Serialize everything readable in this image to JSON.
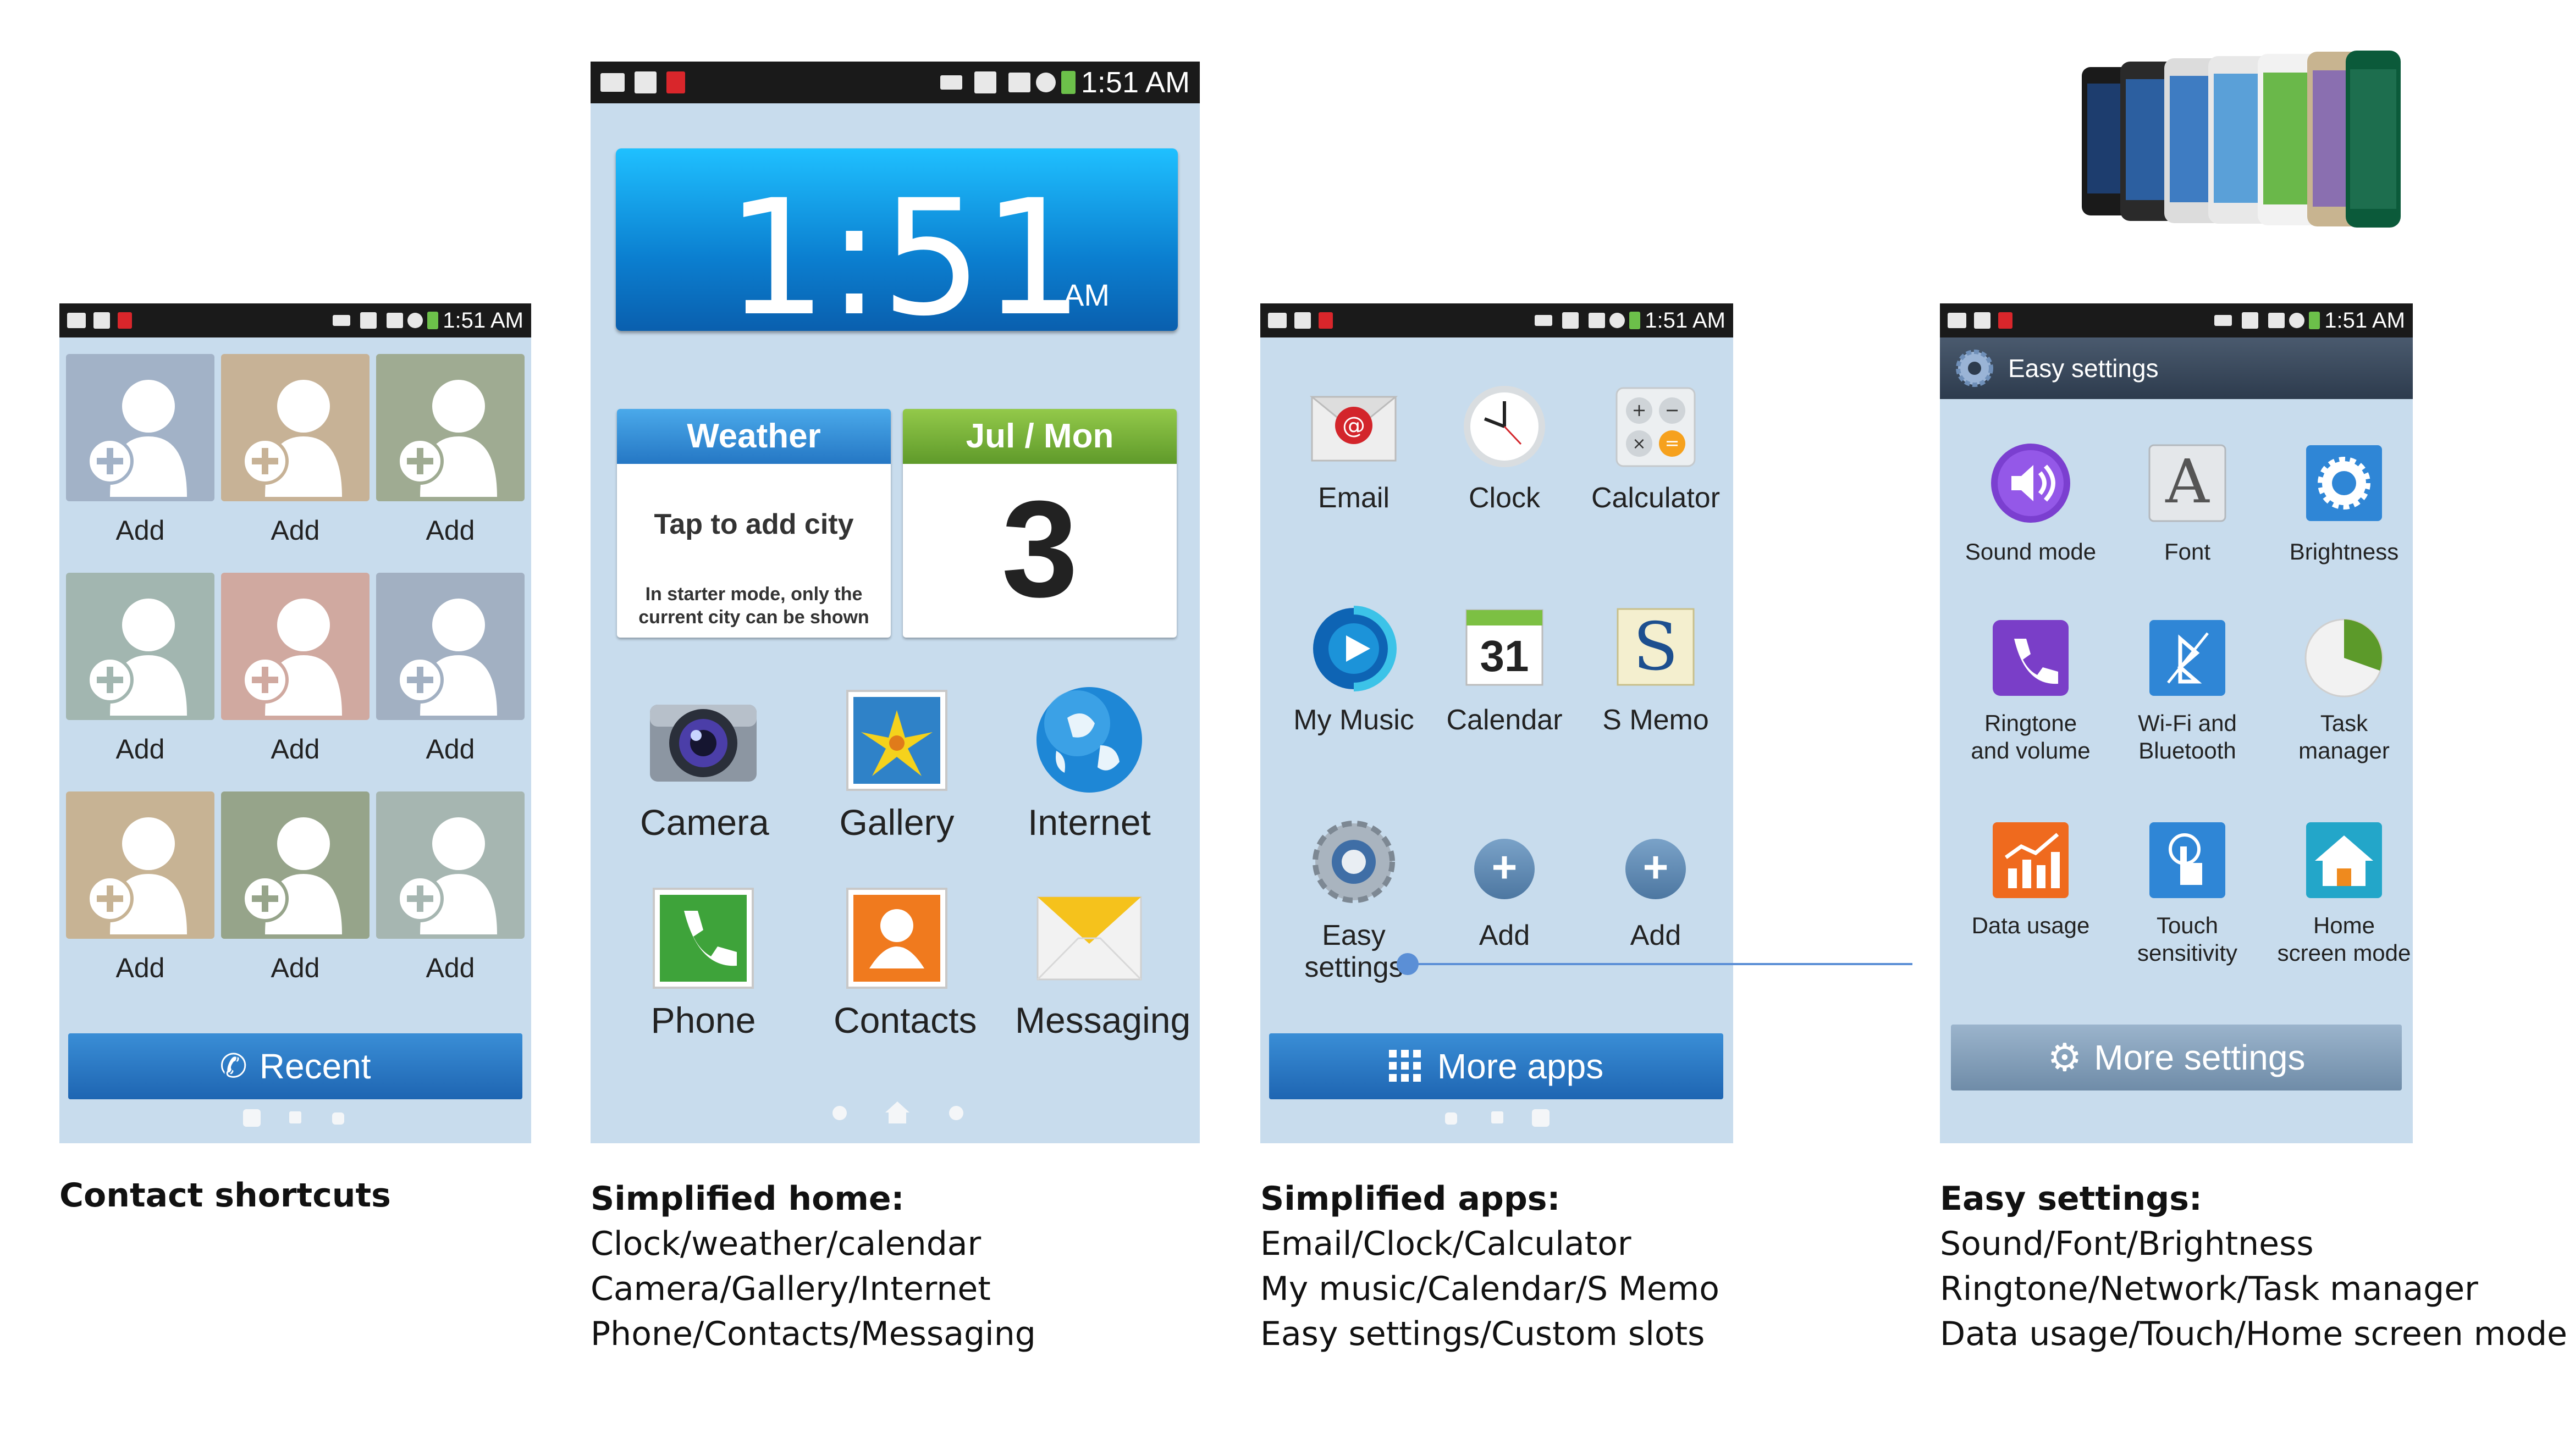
{
  "status": {
    "time": "1:51 AM"
  },
  "panel1": {
    "contacts": [
      {
        "label": "Add",
        "color": "#a2b2c7"
      },
      {
        "label": "Add",
        "color": "#c7b296"
      },
      {
        "label": "Add",
        "color": "#9fab92"
      },
      {
        "label": "Add",
        "color": "#a2b6b0"
      },
      {
        "label": "Add",
        "color": "#d0a9a0"
      },
      {
        "label": "Add",
        "color": "#a2b0c2"
      },
      {
        "label": "Add",
        "color": "#c7b394"
      },
      {
        "label": "Add",
        "color": "#96a48a"
      },
      {
        "label": "Add",
        "color": "#a6b6b1"
      }
    ],
    "recent_label": "Recent"
  },
  "panel2": {
    "clock": {
      "time": "1:51",
      "ampm": "AM"
    },
    "weather": {
      "title": "Weather",
      "tap": "Tap to add city",
      "note1": "In starter mode, only the",
      "note2": "current city can be shown"
    },
    "calendar": {
      "header": "Jul / Mon",
      "day": "3"
    },
    "apps": [
      {
        "label": "Camera",
        "icon": "camera-icon"
      },
      {
        "label": "Gallery",
        "icon": "gallery-icon"
      },
      {
        "label": "Internet",
        "icon": "globe-icon"
      },
      {
        "label": "Phone",
        "icon": "phone-icon"
      },
      {
        "label": "Contacts",
        "icon": "contacts-icon"
      },
      {
        "label": "Messaging",
        "icon": "envelope-icon"
      }
    ]
  },
  "panel3": {
    "apps": [
      {
        "label": "Email",
        "icon": "email-icon"
      },
      {
        "label": "Clock",
        "icon": "clock-icon"
      },
      {
        "label": "Calculator",
        "icon": "calculator-icon"
      },
      {
        "label": "My Music",
        "icon": "music-icon"
      },
      {
        "label": "Calendar",
        "icon": "calendar-icon"
      },
      {
        "label": "S Memo",
        "icon": "memo-icon"
      },
      {
        "label1": "Easy",
        "label2": "settings",
        "icon": "gear-icon"
      },
      {
        "label": "Add",
        "icon": "plus-icon"
      },
      {
        "label": "Add",
        "icon": "plus-icon"
      }
    ],
    "calendar_day": "31",
    "memo_letter": "S",
    "more_apps": "More apps"
  },
  "panel4": {
    "header": "Easy settings",
    "items": [
      {
        "l1": "Sound mode",
        "l2": "",
        "icon": "speaker-icon"
      },
      {
        "l1": "Font",
        "l2": "",
        "icon": "font-icon"
      },
      {
        "l1": "Brightness",
        "l2": "",
        "icon": "brightness-icon"
      },
      {
        "l1": "Ringtone",
        "l2": "and volume",
        "icon": "ringtone-icon"
      },
      {
        "l1": "Wi-Fi and",
        "l2": "Bluetooth",
        "icon": "bluetooth-icon"
      },
      {
        "l1": "Task",
        "l2": "manager",
        "icon": "pie-icon"
      },
      {
        "l1": "Data usage",
        "l2": "",
        "icon": "data-usage-icon"
      },
      {
        "l1": "Touch",
        "l2": "sensitivity",
        "icon": "touch-icon"
      },
      {
        "l1": "Home",
        "l2": "screen mode",
        "icon": "home-icon"
      }
    ],
    "font_letter": "A",
    "more_settings": "More settings"
  },
  "captions": {
    "c1": {
      "title": "Contact shortcuts"
    },
    "c2": {
      "title": "Simplified home:",
      "lines": [
        "Clock/weather/calendar",
        "Camera/Gallery/Internet",
        "Phone/Contacts/Messaging"
      ]
    },
    "c3": {
      "title": "Simplified apps:",
      "lines": [
        "Email/Clock/Calculator",
        "My music/Calendar/S Memo",
        "Easy settings/Custom slots"
      ]
    },
    "c4": {
      "title": "Easy settings:",
      "lines": [
        "Sound/Font/Brightness",
        "Ringtone/Network/Task manager",
        "Data usage/Touch/Home screen mode"
      ]
    }
  },
  "colors": {
    "phone_bg": "#c8dced",
    "accent_blue": "#1e65b2",
    "connector": "#5b8fd6"
  }
}
